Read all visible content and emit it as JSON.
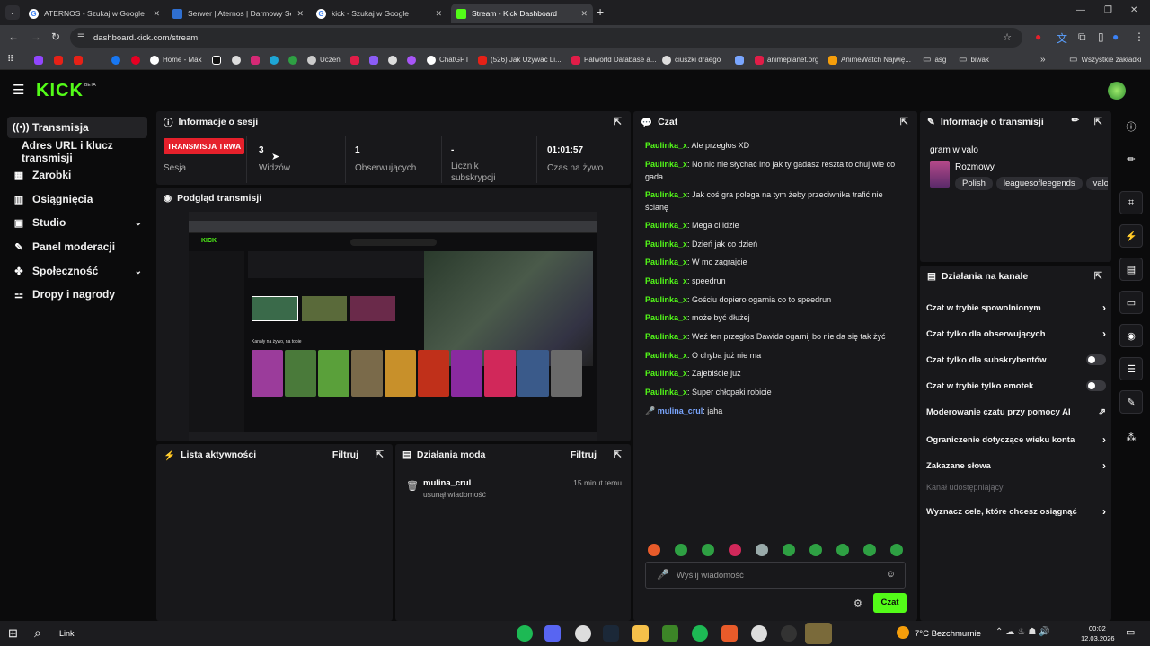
{
  "browser": {
    "tabs": [
      {
        "title": "ATERNOS - Szukaj w Google",
        "icon": "google-icon"
      },
      {
        "title": "Serwer | Aternos | Darmowy Ser...",
        "icon": "aternos-icon"
      },
      {
        "title": "kick - Szukaj w Google",
        "icon": "google-icon"
      },
      {
        "title": "Stream - Kick Dashboard",
        "icon": "kick-icon"
      }
    ],
    "new_tab": "+",
    "url": "dashboard.kick.com/stream",
    "bookmarks": [
      "Home - Max",
      "Uczeń",
      "ChatGPT",
      "(526) Jak Używać Li...",
      "Palworld Database a...",
      "ciuszki draego",
      "animeplanet.org",
      "AnimeWatch Najwię...",
      "asg",
      "biwak"
    ],
    "all_bookmarks": "Wszystkie zakładki"
  },
  "kick": {
    "logo": "KICK",
    "logo_badge": "BETA",
    "sidebar": [
      {
        "label": "Transmisja",
        "icon": "broadcast-icon",
        "active": true
      },
      {
        "label": "Adres URL i klucz transmisji",
        "icon": "",
        "active": false
      },
      {
        "label": "Zarobki",
        "icon": "earnings-icon",
        "active": false
      },
      {
        "label": "Osiągnięcia",
        "icon": "achievements-icon",
        "active": false
      },
      {
        "label": "Studio",
        "icon": "studio-icon",
        "active": false,
        "chevron": true
      },
      {
        "label": "Panel moderacji",
        "icon": "wrench-icon",
        "active": false
      },
      {
        "label": "Społeczność",
        "icon": "community-icon",
        "active": false,
        "chevron": true
      },
      {
        "label": "Dropy i nagrody",
        "icon": "drops-icon",
        "active": false
      }
    ],
    "session": {
      "title": "Informacje o sesji",
      "live_badge": "TRANSMISJA TRWA",
      "session_label": "Sesja",
      "viewers_value": "3",
      "viewers_label": "Widzów",
      "followers_value": "1",
      "followers_label": "Obserwujących",
      "subs_value": "-",
      "subs_label": "Licznik subskrypcji",
      "time_value": "01:01:57",
      "time_label": "Czas na żywo"
    },
    "preview": {
      "title": "Podgląd transmisji"
    },
    "activity": {
      "title": "Lista aktywności",
      "filter": "Filtruj"
    },
    "mod": {
      "title": "Działania moda",
      "filter": "Filtruj",
      "entry_user": "mulina_crul",
      "entry_action": "usunął wiadomość",
      "entry_time": "15 minut temu"
    },
    "chat": {
      "title": "Czat",
      "messages": [
        {
          "user": "Paulinka_x",
          "text": "Ale przegłos XD"
        },
        {
          "user": "Paulinka_x",
          "text": "No nic nie słychać ino jak ty gadasz reszta to chuj wie co gada"
        },
        {
          "user": "Paulinka_x",
          "text": "Jak coś gra polega na tym żeby przeciwnika trafić nie ścianę"
        },
        {
          "user": "Paulinka_x",
          "text": "Mega ci idzie"
        },
        {
          "user": "Paulinka_x",
          "text": "Dzień jak co dzień"
        },
        {
          "user": "Paulinka_x",
          "text": "W mc zagrajcie"
        },
        {
          "user": "Paulinka_x",
          "text": "speedrun"
        },
        {
          "user": "Paulinka_x",
          "text": "Gościu dopiero ogarnia co to speedrun"
        },
        {
          "user": "Paulinka_x",
          "text": "może być dłużej"
        },
        {
          "user": "Paulinka_x",
          "text": "Weź ten przegłos Dawida ogarnij bo nie da się tak żyć"
        },
        {
          "user": "Paulinka_x",
          "text": "O chyba już nie ma"
        },
        {
          "user": "Paulinka_x",
          "text": "Zajebiście już"
        },
        {
          "user": "Paulinka_x",
          "text": "Super chłopaki robicie"
        }
      ],
      "mod_message": {
        "user": "mulina_crul",
        "text": "jaha"
      },
      "placeholder": "Wyślij wiadomość",
      "send_button": "Czat"
    },
    "stream_info": {
      "title": "Informacje o transmisji",
      "stream_title": "gram w valo",
      "category": "Rozmowy",
      "tags": [
        "Polish",
        "leaguesofleegends",
        "valo"
      ]
    },
    "channel_actions": {
      "title": "Działania na kanale",
      "items": [
        {
          "label": "Czat w trybie spowolnionym",
          "control": "chevron"
        },
        {
          "label": "Czat tylko dla obserwujących",
          "control": "chevron"
        },
        {
          "label": "Czat tylko dla subskrybentów",
          "control": "toggle"
        },
        {
          "label": "Czat w trybie tylko emotek",
          "control": "toggle"
        },
        {
          "label": "Moderowanie czatu przy pomocy AI",
          "control": "external"
        },
        {
          "label": "Ograniczenie dotyczące wieku konta",
          "control": "chevron"
        },
        {
          "label": "Zakazane słowa",
          "control": "chevron"
        },
        {
          "label": "Kanał udostępniający",
          "control": "none"
        },
        {
          "label": "Wyznacz cele, które chcesz osiągnąć",
          "control": "chevron"
        }
      ]
    }
  },
  "taskbar": {
    "links": "Linki",
    "weather": "7°C Bezchmurnie",
    "time": "00:02",
    "date": "12.03.2026"
  },
  "colors": {
    "accent": "#53fc18",
    "live": "#e5202b",
    "panel": "#18181b",
    "bg": "#0b0b0c"
  }
}
